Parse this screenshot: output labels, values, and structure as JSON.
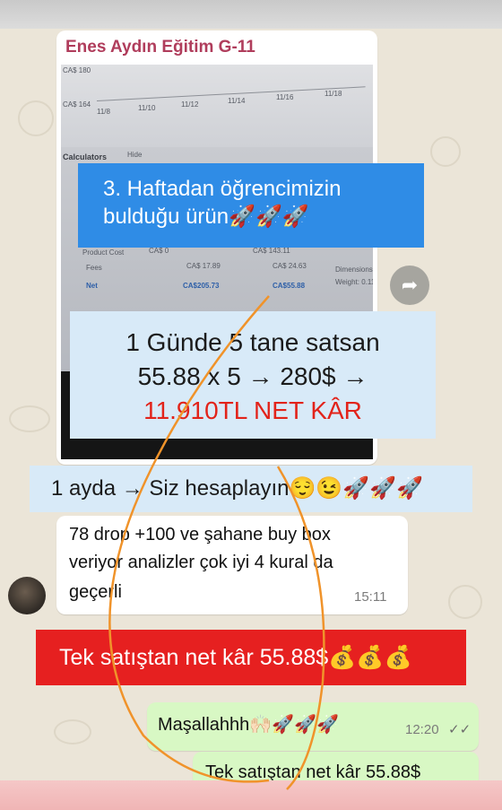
{
  "chat": {
    "sender_name": "Enes Aydın Eğitim G-11",
    "forward_icon": "forward-arrow-icon"
  },
  "photo": {
    "axis_top": "CA$ 180",
    "axis_mid": "CA$ 164",
    "dates": [
      "11/8",
      "11/10",
      "11/12",
      "11/14",
      "11/16",
      "11/18"
    ],
    "calculators": "Calculators",
    "hide": "Hide",
    "product_cost_label": "Product Cost",
    "product_cost_a": "CA$ 0",
    "product_cost_b": "CA$ 143.11",
    "fees_label": "Fees",
    "fees_a": "CA$ 17.89",
    "fees_b": "CA$ 24.63",
    "dimensions_label": "Dimensions:",
    "net_label": "Net",
    "net_a": "CA$205.73",
    "net_b": "CA$55.88",
    "weight_label": "Weight: 0.11"
  },
  "overlay": {
    "week_line1": "3. Haftadan öğrencimizin",
    "week_line2": "bulduğu ürün🚀🚀🚀",
    "sales_line1": "1 Günde 5 tane satsan",
    "sales_line2": "55.88 x 5 → 280$ →",
    "sales_line3": "11.910TL NET KÂR",
    "month_line": "1 ayda → Siz hesaplayın😌😉🚀🚀🚀",
    "net_profit": "Tek satıştan net kâr 55.88$💰💰💰"
  },
  "messages": [
    {
      "line1": "78 drop +100 ve şahane buy box",
      "line2": "veriyor analizler çok iyi 4 kural da",
      "line3": "geçerli",
      "time": "15:11"
    }
  ],
  "outgoing": [
    {
      "text": "Maşallahhh🙌🏻🚀🚀🚀",
      "time": "12:20",
      "status": "✓✓"
    },
    {
      "text": "Tek satıştan net kâr 55.88$"
    }
  ],
  "colors": {
    "accent_blue": "#2f8ce6",
    "callout_light": "#d8eaf8",
    "callout_red": "#e62020",
    "outgoing_bubble": "#d8f8c4",
    "sender_name": "#b03d5c",
    "highlight_red": "#e2231a"
  }
}
